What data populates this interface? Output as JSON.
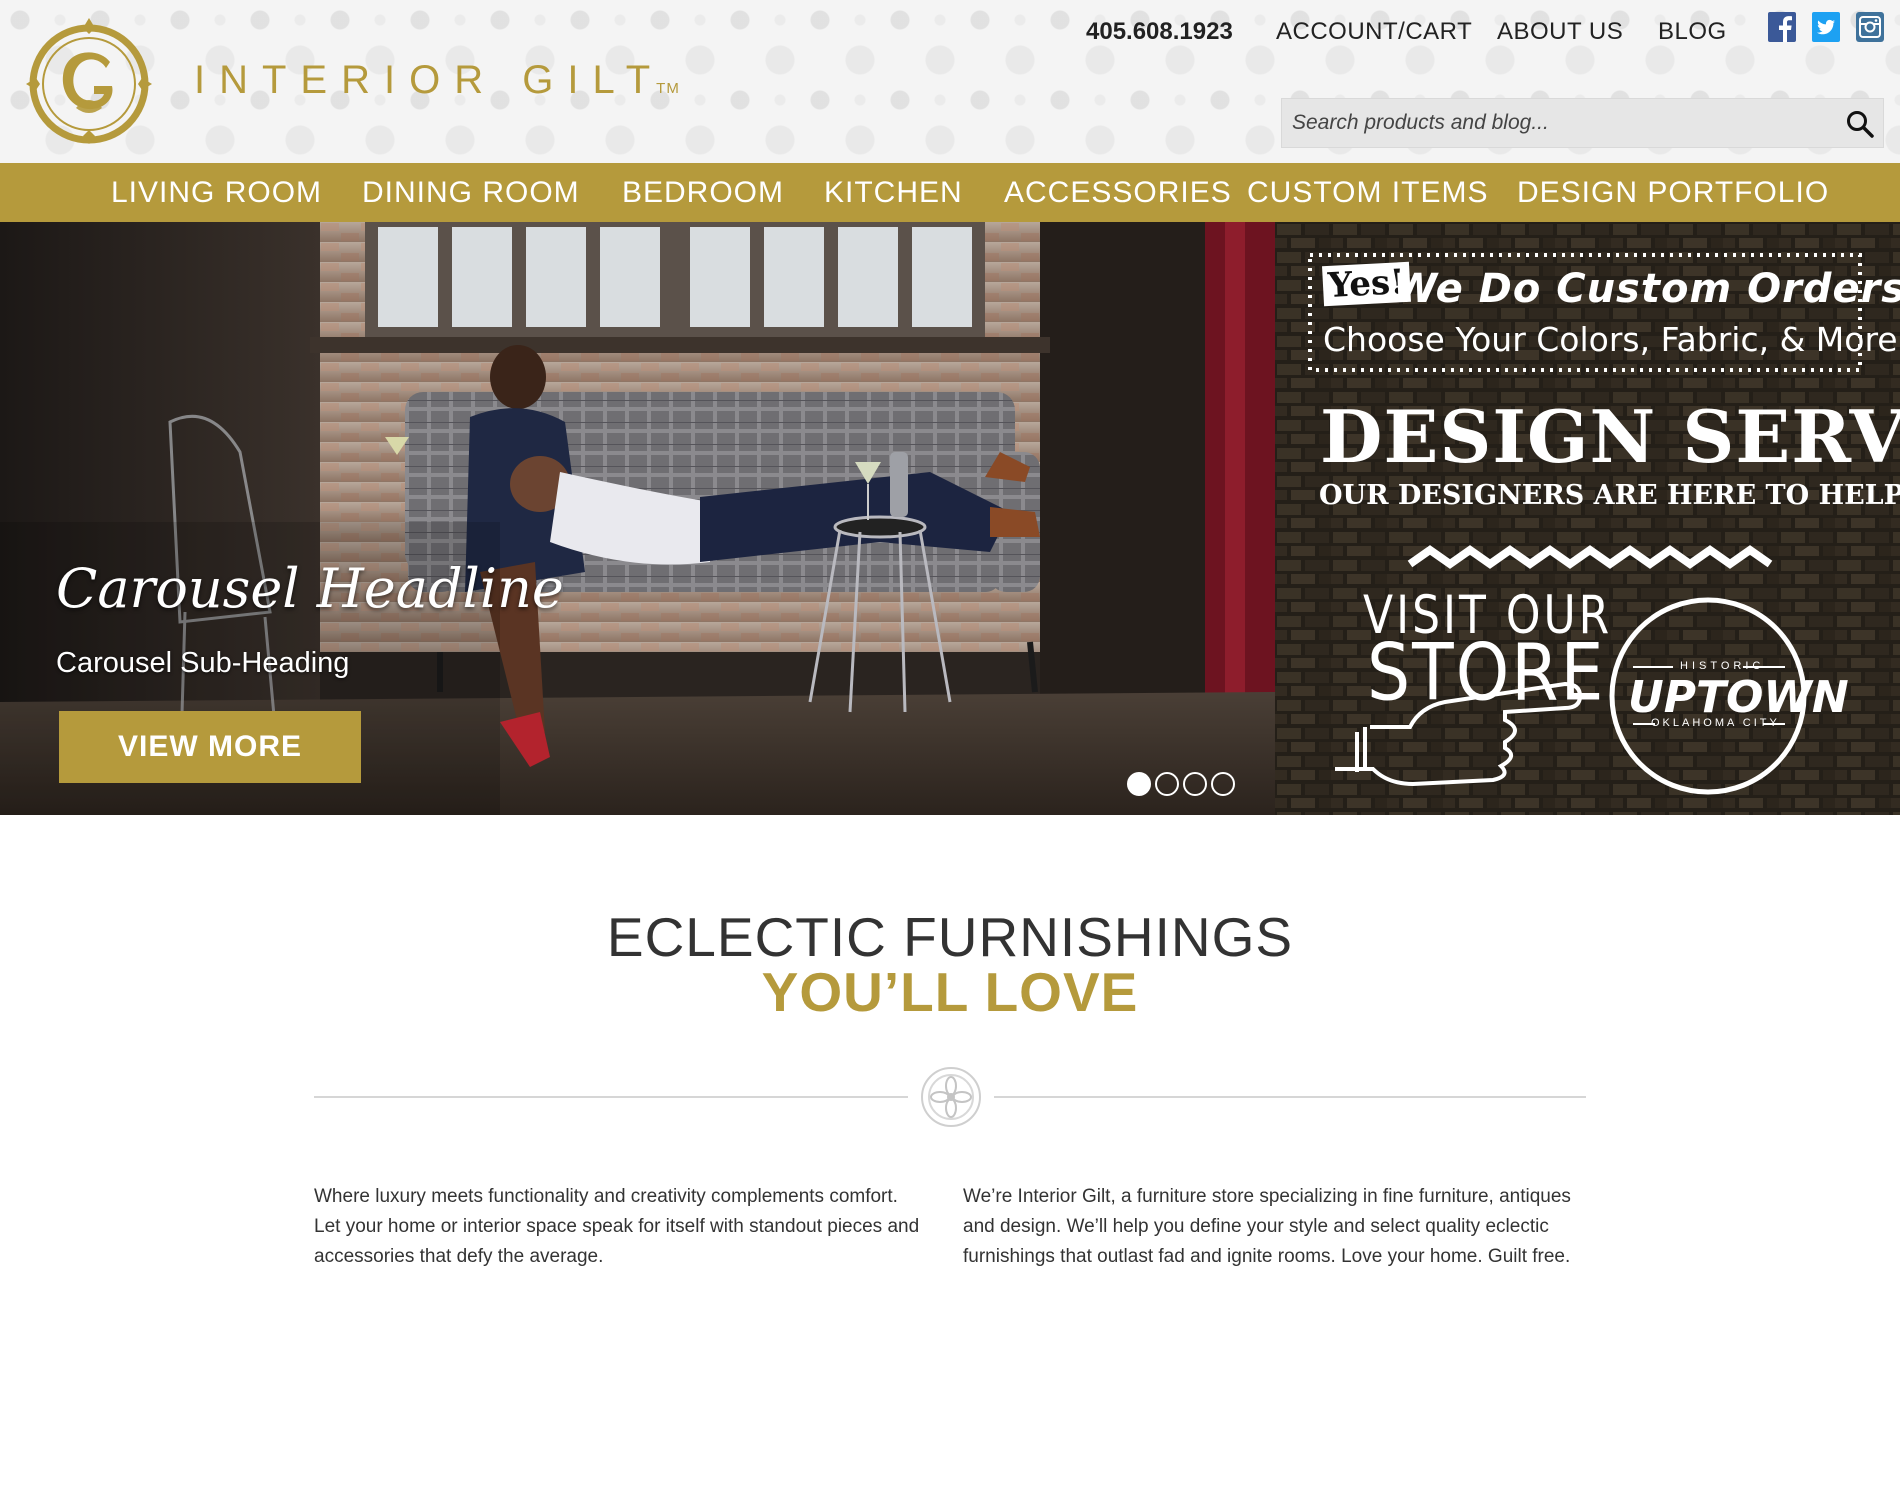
{
  "header": {
    "brand": "INTERIOR GILT",
    "brand_tm": "TM",
    "phone": "405.608.1923",
    "links": [
      "ACCOUNT/CART",
      "ABOUT US",
      "BLOG"
    ],
    "social_icons": [
      "facebook-icon",
      "twitter-icon",
      "instagram-icon"
    ],
    "search_placeholder": "Search products and blog..."
  },
  "nav": {
    "items": [
      "LIVING ROOM",
      "DINING ROOM",
      "BEDROOM",
      "KITCHEN",
      "ACCESSORIES",
      "CUSTOM ITEMS",
      "DESIGN PORTFOLIO"
    ]
  },
  "hero": {
    "headline": "Carousel Headline",
    "subheading": "Carousel Sub-Heading",
    "button": "VIEW MORE",
    "slide_count": 4,
    "active_slide": 1
  },
  "promo": {
    "yes_badge": "Yes!",
    "custom_orders": "We Do Custom Orders!",
    "custom_sub": "Choose Your Colors, Fabric, & More...",
    "design_services": "DESIGN SERVICES",
    "designers_help": "OUR DESIGNERS ARE HERE TO HELP YOU!",
    "visit_line1": "VISIT OUR",
    "visit_line2": "STORE",
    "badge_top": "HISTORIC",
    "badge_main": "UPTOWN",
    "badge_bottom": "OKLAHOMA CITY"
  },
  "content": {
    "headline_main": "ECLECTIC FURNISHINGS",
    "headline_accent": "YOU’LL LOVE",
    "para_left": "Where luxury meets functionality and creativity complements comfort. Let your home or interior space speak for itself with standout pieces and accessories that defy the average.",
    "para_right": "We’re Interior Gilt, a furniture store specializing in fine furniture, antiques and design. We’ll help you define your style and select quality eclectic furnishings that outlast fad and ignite rooms. Love your home. Guilt free."
  },
  "colors": {
    "gold": "#b59a3c",
    "facebook": "#3b5998",
    "twitter": "#1da1f2",
    "instagram": "#3f729b"
  }
}
